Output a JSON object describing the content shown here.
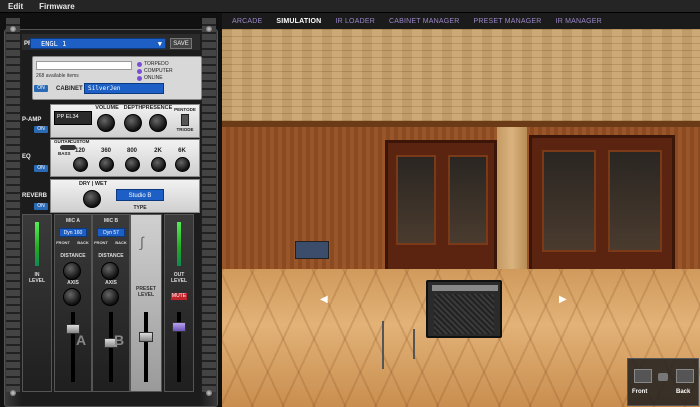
{
  "menu": {
    "edit": "Edit",
    "firmware": "Firmware"
  },
  "tabs": [
    {
      "label": "ARCADE",
      "active": false
    },
    {
      "label": "SIMULATION",
      "active": true
    },
    {
      "label": "IR LOADER",
      "active": false
    },
    {
      "label": "CABINET MANAGER",
      "active": false
    },
    {
      "label": "PRESET MANAGER",
      "active": false
    },
    {
      "label": "IR MANAGER",
      "active": false
    }
  ],
  "preset": {
    "label": "PRESET",
    "value": "ENGL 1",
    "save": "SAVE"
  },
  "browser": {
    "count": "268 available items",
    "sources": [
      "TORPEDO",
      "COMPUTER",
      "ONLINE"
    ],
    "on": "ON",
    "cabinet_label": "CABINET",
    "cabinet_value": "SilverJen"
  },
  "pamp": {
    "label": "P-AMP",
    "on": "ON",
    "tube": "PP EL34",
    "knobs": [
      "VOLUME",
      "DEPTH",
      "PRESENCE"
    ],
    "switch_top": "PENTODE",
    "switch_bottom": "TRIODE"
  },
  "eq": {
    "label": "EQ",
    "on": "ON",
    "mode": [
      "GUITAR",
      "CUSTOM"
    ],
    "bass": "BASS",
    "bands": [
      "120",
      "360",
      "800",
      "2K",
      "6K"
    ]
  },
  "reverb": {
    "label": "REVERB",
    "on": "ON",
    "mix": "DRY | WET",
    "type_value": "Studio B",
    "type_label": "TYPE"
  },
  "mixer": {
    "in_level": "IN\nLEVEL",
    "out_level": "OUT\nLEVEL",
    "mute": "MUTE",
    "preset_level": "PRESET LEVEL",
    "mic_a": {
      "label": "MIC A",
      "value": "Dyn 160",
      "front": "FRONT",
      "back": "BACK",
      "distance": "DISTANCE",
      "axis": "AXIS",
      "letter": "A"
    },
    "mic_b": {
      "label": "MIC B",
      "value": "Dyn 57",
      "front": "FRONT",
      "back": "BACK",
      "distance": "DISTANCE",
      "axis": "AXIS",
      "letter": "B"
    }
  },
  "view": {
    "front": "Front",
    "back": "Back"
  },
  "colors": {
    "accent_blue": "#1d5fc4",
    "tab_inactive": "#9b88c9",
    "mute_red": "#c0242a"
  }
}
